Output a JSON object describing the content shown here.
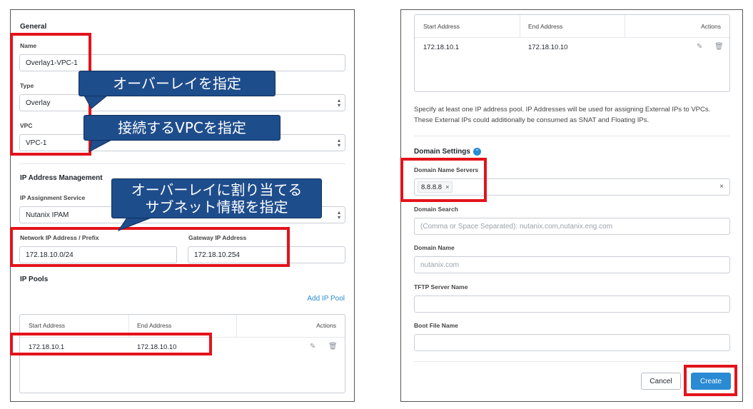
{
  "left": {
    "general_title": "General",
    "name_label": "Name",
    "name_value": "Overlay1-VPC-1",
    "type_label": "Type",
    "type_value": "Overlay",
    "vpc_label": "VPC",
    "vpc_value": "VPC-1",
    "ipam_title": "IP Address Management",
    "ip_assignment_label": "IP Assignment Service",
    "ip_assignment_value": "Nutanix IPAM",
    "network_ip_label": "Network IP Address / Prefix",
    "network_ip_value": "172.18.10.0/24",
    "gateway_label": "Gateway IP Address",
    "gateway_value": "172.18.10.254",
    "ip_pools_title": "IP Pools",
    "add_ip_pool": "Add IP Pool",
    "table_headers": {
      "start": "Start Address",
      "end": "End Address",
      "actions": "Actions"
    },
    "pool_row": {
      "start": "172.18.10.1",
      "end": "172.18.10.10"
    }
  },
  "right": {
    "table_headers": {
      "start": "Start Address",
      "end": "End Address",
      "actions": "Actions"
    },
    "pool_row": {
      "start": "172.18.10.1",
      "end": "172.18.10.10"
    },
    "help_line1": "Specify at least one IP address pool. IP Addresses will be used for assigning External IPs to VPCs.",
    "help_line2": "These External IPs could additionally be consumed as SNAT and Floating IPs.",
    "domain_settings_title": "Domain Settings",
    "dns_label": "Domain Name Servers",
    "dns_chip": "8.8.8.8",
    "domain_search_label": "Domain Search",
    "domain_search_placeholder": "(Comma or Space Separated): nutanix.com,nutanix.eng.com",
    "domain_name_label": "Domain Name",
    "domain_name_placeholder": "nutanix.com",
    "tftp_label": "TFTP Server Name",
    "boot_file_label": "Boot File Name",
    "cancel_label": "Cancel",
    "create_label": "Create"
  },
  "callouts": {
    "overlay": "オーバーレイを指定",
    "vpc": "接続するVPCを指定",
    "subnet_line1": "オーバーレイに割り当てる",
    "subnet_line2": "サブネット情報を指定"
  },
  "colors": {
    "accent": "#2a8ad3",
    "highlight": "#e3131b",
    "callout": "#1e4d8c"
  }
}
